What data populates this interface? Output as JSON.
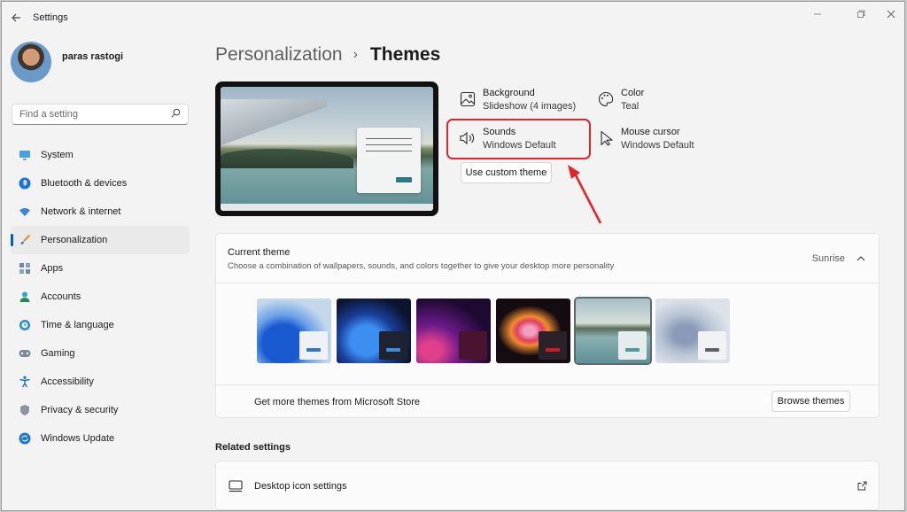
{
  "window": {
    "app_title": "Settings",
    "icons": {
      "back": "back-arrow-icon",
      "minimize": "minimize-icon",
      "maximize": "restore-icon",
      "close": "close-icon"
    }
  },
  "sidebar": {
    "user_name": "paras rastogi",
    "search_placeholder": "Find a setting",
    "items": [
      {
        "label": "System",
        "icon": "monitor-icon",
        "active": false
      },
      {
        "label": "Bluetooth & devices",
        "icon": "bluetooth-icon",
        "active": false
      },
      {
        "label": "Network & internet",
        "icon": "wifi-icon",
        "active": false
      },
      {
        "label": "Personalization",
        "icon": "brush-icon",
        "active": true
      },
      {
        "label": "Apps",
        "icon": "apps-icon",
        "active": false
      },
      {
        "label": "Accounts",
        "icon": "person-icon",
        "active": false
      },
      {
        "label": "Time & language",
        "icon": "clock-globe-icon",
        "active": false
      },
      {
        "label": "Gaming",
        "icon": "gamepad-icon",
        "active": false
      },
      {
        "label": "Accessibility",
        "icon": "accessibility-icon",
        "active": false
      },
      {
        "label": "Privacy & security",
        "icon": "shield-icon",
        "active": false
      },
      {
        "label": "Windows Update",
        "icon": "update-icon",
        "active": false
      }
    ],
    "accent_color": "#005fb8"
  },
  "header": {
    "parent": "Personalization",
    "separator": "›",
    "current": "Themes"
  },
  "theme_attributes": {
    "background": {
      "title": "Background",
      "value": "Slideshow (4 images)",
      "icon": "image-icon"
    },
    "color": {
      "title": "Color",
      "value": "Teal",
      "icon": "palette-icon"
    },
    "sounds": {
      "title": "Sounds",
      "value": "Windows Default",
      "icon": "speaker-icon"
    },
    "mouse_cursor": {
      "title": "Mouse cursor",
      "value": "Windows Default",
      "icon": "cursor-icon"
    },
    "custom_button": "Use custom theme"
  },
  "current_theme": {
    "title": "Current theme",
    "description": "Choose a combination of wallpapers, sounds, and colors together to give your desktop more personality",
    "selected": "Sunrise",
    "thumbnails": [
      {
        "name": "windows-light",
        "bg": "#b9cde0",
        "win": "#eef2f6",
        "bar": "#2f77c8",
        "selected": false
      },
      {
        "name": "windows-dark",
        "bg": "#1a2a58",
        "win": "#1f2230",
        "bar": "#3a8fd8",
        "selected": false
      },
      {
        "name": "glow",
        "bg": "#2a0e3a",
        "win": "#4a1430",
        "bar": "#4a1430",
        "selected": false
      },
      {
        "name": "captured-motion",
        "bg": "#1a1012",
        "win": "#2a2228",
        "bar": "#d01a24",
        "selected": false
      },
      {
        "name": "sunrise",
        "bg": "#8fb0b4",
        "win": "#e6ecec",
        "bar": "#4a9aa0",
        "selected": true
      },
      {
        "name": "flow",
        "bg": "#c4ccd6",
        "win": "#f0f2f4",
        "bar": "#5a6068",
        "selected": false
      }
    ],
    "store_text": "Get more themes from Microsoft Store",
    "browse_button": "Browse themes"
  },
  "related": {
    "title": "Related settings",
    "item_label": "Desktop icon settings",
    "item_icon": "desktop-icon",
    "link_icon": "open-external-icon"
  },
  "annotation_color": "#e0262c"
}
